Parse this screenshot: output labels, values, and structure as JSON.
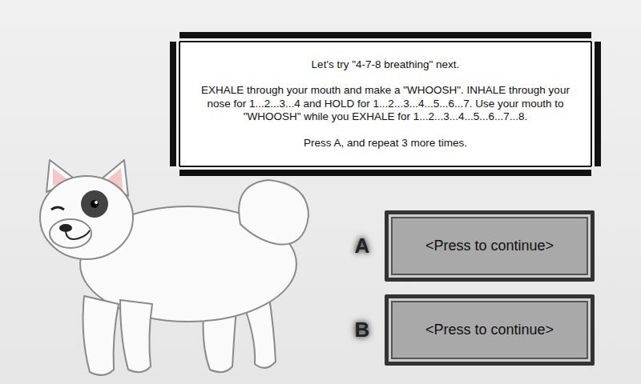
{
  "dialog": {
    "paragraphs": [
      "Let's try \"4-7-8 breathing\" next.",
      "EXHALE through your mouth and make a \"WHOOSH\". INHALE through your nose for 1...2...3...4 and HOLD for 1...2...3...4...5...6...7. Use your mouth to \"WHOOSH\" while you EXHALE for 1...2...3...4...5...6...7...8.",
      "Press A, and repeat 3 more times."
    ]
  },
  "choices": [
    {
      "key": "A",
      "label": "<Press to continue>"
    },
    {
      "key": "B",
      "label": "<Press to continue>"
    }
  ]
}
